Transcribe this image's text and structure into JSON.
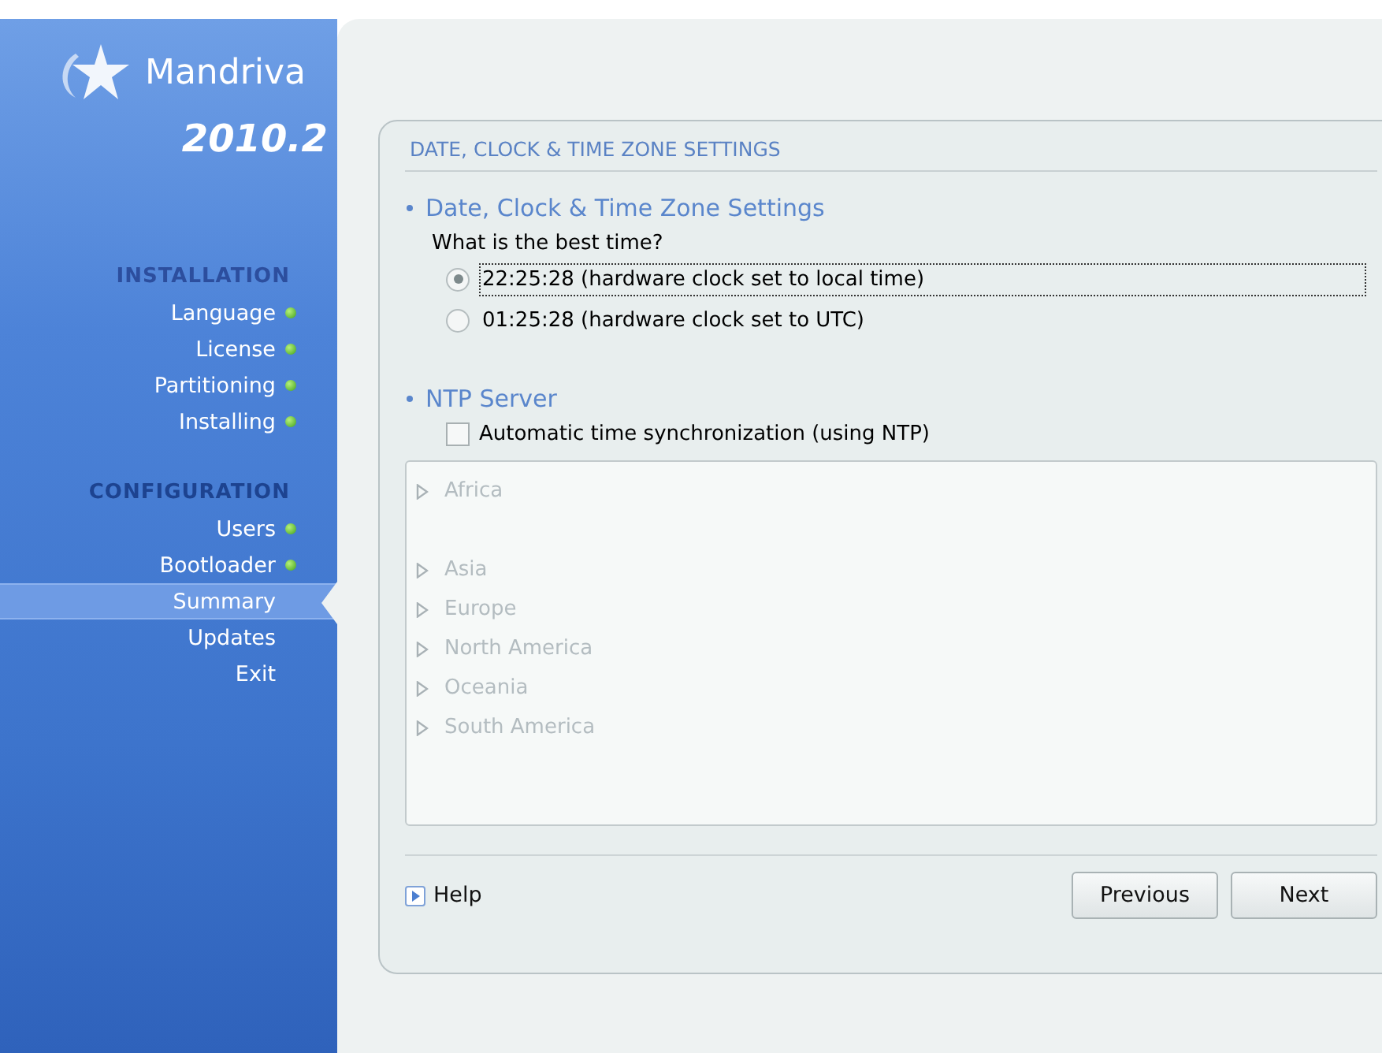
{
  "sidebar": {
    "logo": {
      "brand": "Mandriva",
      "version": "2010.2"
    },
    "sections": [
      {
        "title": "INSTALLATION",
        "active": true,
        "items": [
          {
            "label": "Language",
            "done": true,
            "selected": false
          },
          {
            "label": "License",
            "done": true,
            "selected": false
          },
          {
            "label": "Partitioning",
            "done": true,
            "selected": false
          },
          {
            "label": "Installing",
            "done": true,
            "selected": false
          }
        ]
      },
      {
        "title": "CONFIGURATION",
        "active": false,
        "items": [
          {
            "label": "Users",
            "done": true,
            "selected": false
          },
          {
            "label": "Bootloader",
            "done": true,
            "selected": false
          },
          {
            "label": "Summary",
            "done": false,
            "selected": true
          },
          {
            "label": "Updates",
            "done": false,
            "selected": false
          },
          {
            "label": "Exit",
            "done": false,
            "selected": false
          }
        ]
      }
    ]
  },
  "panel": {
    "title": "DATE, CLOCK & TIME ZONE SETTINGS",
    "clock_section": {
      "heading": "Date, Clock & Time Zone Settings",
      "question": "What is the best time?",
      "options": [
        {
          "label": "22:25:28 (hardware clock set to local time)",
          "selected": true,
          "focused": true
        },
        {
          "label": "01:25:28 (hardware clock set to UTC)",
          "selected": false,
          "focused": false
        }
      ]
    },
    "ntp_section": {
      "heading": "NTP Server",
      "checkbox": {
        "label": "Automatic time synchronization (using NTP)",
        "checked": false
      }
    },
    "tree": {
      "disabled": true,
      "groups": [
        [
          {
            "label": "Africa",
            "expanded": false
          }
        ],
        [
          {
            "label": "Asia",
            "expanded": false
          },
          {
            "label": "Europe",
            "expanded": false
          },
          {
            "label": "North America",
            "expanded": false
          },
          {
            "label": "Oceania",
            "expanded": false
          },
          {
            "label": "South America",
            "expanded": false
          }
        ]
      ]
    },
    "help": "Help",
    "buttons": [
      "Previous",
      "Next"
    ]
  }
}
